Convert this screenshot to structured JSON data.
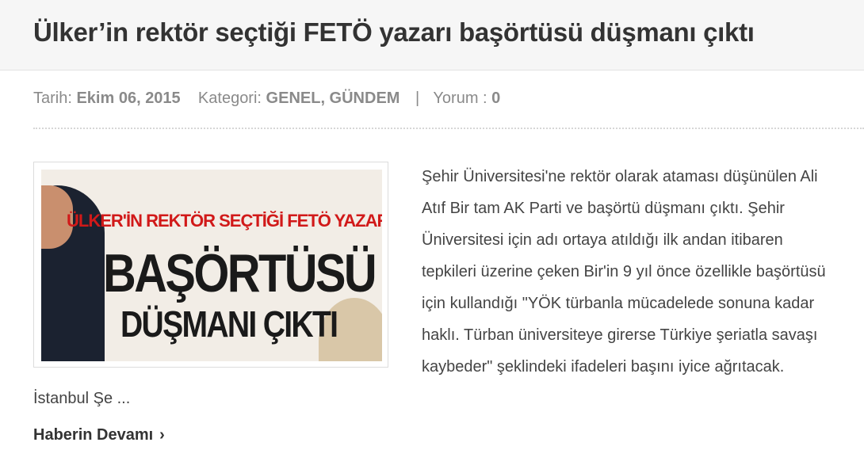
{
  "post": {
    "title": "Ülker’in rektör seçtiği FETÖ yazarı başörtüsü düşmanı çıktı",
    "meta": {
      "date_label": "Tarih:",
      "date_value": "Ekim 06, 2015",
      "category_label": "Kategori:",
      "category_value": "GENEL, GÜNDEM",
      "separator": "|",
      "comments_label": "Yorum :",
      "comments_value": "0"
    },
    "image": {
      "line1": "ÜLKER'İN REKTÖR SEÇTİĞİ FETÖ YAZARI",
      "line2": "BAŞÖRTÜSÜ",
      "line3": "DÜŞMANI ÇIKTI"
    },
    "excerpt": "Şehir Üniversitesi'ne rektör olarak ataması düşünülen Ali Atıf Bir tam AK Parti ve başörtü düşmanı çıktı. Şehir Üniversitesi için adı ortaya atıldığı ilk andan itibaren tepkileri üzerine çeken Bir'in 9 yıl önce özellikle başörtüsü için kullandığı \"YÖK türbanla mücadelede sonuna kadar haklı. Türban üniversiteye girerse Türkiye şeriatla savaşı kaybeder\" şeklindeki ifadeleri başını iyice ağrıtacak. İstanbul Şe ...",
    "read_more": "Haberin Devamı",
    "read_more_icon": "chevron-right-icon"
  }
}
